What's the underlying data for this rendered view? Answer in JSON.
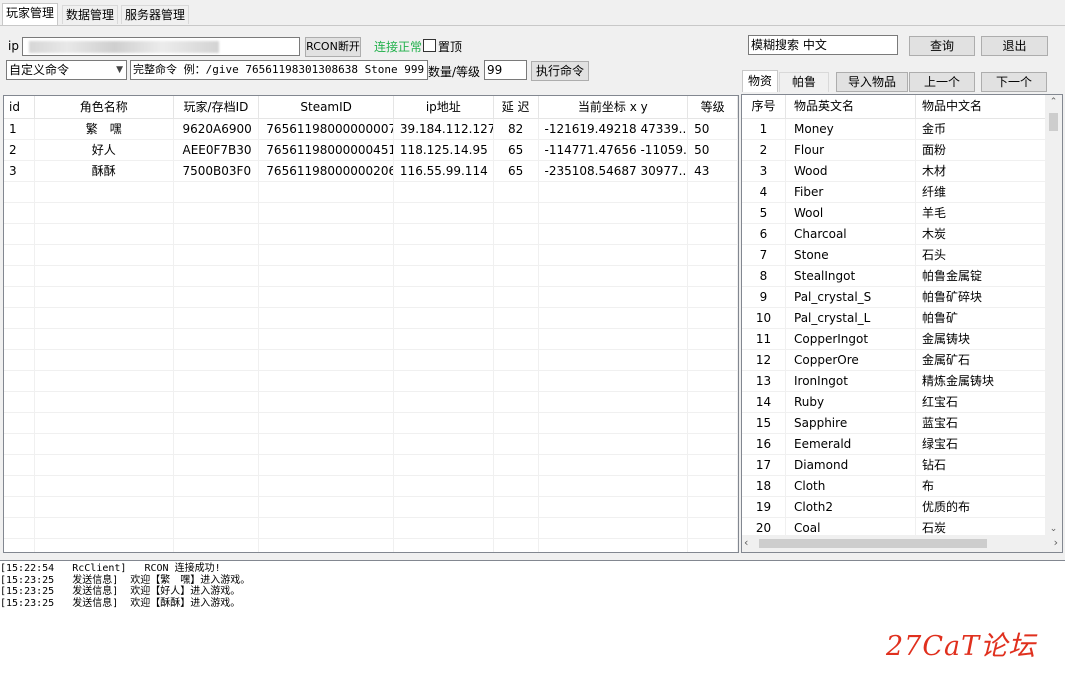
{
  "tabs": [
    "玩家管理",
    "数据管理",
    "服务器管理"
  ],
  "connection": {
    "ip_label": "ip",
    "ip_value": "",
    "rcon_button": "RCON断开",
    "status_text": "连接正常",
    "status_color": "#22b14c",
    "topmost_label": "置顶"
  },
  "command": {
    "select_value": "自定义命令",
    "full_command_label": "完整命令 例：/give 76561198301308638 Stone 999",
    "qty_label": "数量/等级",
    "qty_value": "99",
    "exec_button": "执行命令"
  },
  "search": {
    "value": "模糊搜索 中文",
    "query_button": "查询",
    "exit_button": "退出"
  },
  "item_tabs": {
    "tab1": "物资",
    "tab2": "帕鲁",
    "import_button": "导入物品",
    "prev_button": "上一个",
    "next_button": "下一个"
  },
  "player_table": {
    "headers": [
      "id",
      "角色名称",
      "玩家/存档ID",
      "SteamID",
      "ip地址",
      "延 迟",
      "当前坐标 x y",
      "等级"
    ],
    "rows": [
      [
        "1",
        "繁　嘿",
        "9620A6900",
        "76561198000000007",
        "39.184.112.127",
        "82",
        "-121619.49218 47339....",
        "50"
      ],
      [
        "2",
        "好人",
        "AEE0F7B30",
        "76561198000000451",
        "118.125.14.95",
        "65",
        "-114771.47656 -11059....",
        "50"
      ],
      [
        "3",
        "酥酥",
        "7500B03F0",
        "76561198000000206",
        "116.55.99.114",
        "65",
        "-235108.54687 30977....",
        "43"
      ]
    ]
  },
  "item_table": {
    "headers": [
      "序号",
      "物品英文名",
      "物品中文名"
    ],
    "rows": [
      [
        "1",
        "Money",
        "金币"
      ],
      [
        "2",
        "Flour",
        "面粉"
      ],
      [
        "3",
        "Wood",
        "木材"
      ],
      [
        "4",
        "Fiber",
        "纤维"
      ],
      [
        "5",
        "Wool",
        "羊毛"
      ],
      [
        "6",
        "Charcoal",
        "木炭"
      ],
      [
        "7",
        "Stone",
        "石头"
      ],
      [
        "8",
        "StealIngot",
        "帕鲁金属锭"
      ],
      [
        "9",
        "Pal_crystal_S",
        "帕鲁矿碎块"
      ],
      [
        "10",
        "Pal_crystal_L",
        "帕鲁矿"
      ],
      [
        "11",
        "CopperIngot",
        "金属铸块"
      ],
      [
        "12",
        "CopperOre",
        "金属矿石"
      ],
      [
        "13",
        "IronIngot",
        "精炼金属铸块"
      ],
      [
        "14",
        "Ruby",
        "红宝石"
      ],
      [
        "15",
        "Sapphire",
        "蓝宝石"
      ],
      [
        "16",
        "Eemerald",
        "绿宝石"
      ],
      [
        "17",
        "Diamond",
        "钻石"
      ],
      [
        "18",
        "Cloth",
        "布"
      ],
      [
        "19",
        "Cloth2",
        "优质的布"
      ],
      [
        "20",
        "Coal",
        "石炭"
      ]
    ]
  },
  "log": [
    "[15:22:54   RcClient]   RCON 连接成功!",
    "[15:23:25   发送信息]  欢迎【繁　嘿】进入游戏。",
    "[15:23:25   发送信息]  欢迎【好人】进入游戏。",
    "[15:23:25   发送信息]  欢迎【酥酥】进入游戏。"
  ],
  "watermark": {
    "text": "27CaT论坛",
    "color": "#e0301e"
  }
}
